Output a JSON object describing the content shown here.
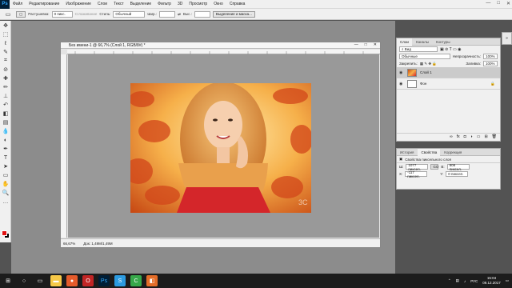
{
  "app": {
    "logo": "Ps"
  },
  "menu": [
    "Файл",
    "Редактирование",
    "Изображение",
    "Слои",
    "Текст",
    "Выделение",
    "Фильтр",
    "3D",
    "Просмотр",
    "Окно",
    "Справка"
  ],
  "window_controls": [
    "—",
    "□",
    "✕"
  ],
  "options": {
    "feather_label": "Растушевка:",
    "feather_value": "0 пикс.",
    "smoothing_label": "Сглаживание",
    "style_label": "Стиль:",
    "style_value": "Обычный",
    "width_label": "Шир.:",
    "height_label": "Выс.:",
    "select_mask_btn": "Выделение и маска..."
  },
  "document": {
    "title": "Без имени-1 @ 66,7% (Слой 1, RGB/8#) *",
    "zoom": "66,67%",
    "doc_info": "Док: 1,49M/1,49M",
    "watermark": "3C"
  },
  "layers_panel": {
    "tabs": [
      "Слои",
      "Каналы",
      "Контуры"
    ],
    "kind_label": "Вид",
    "blend_mode": "Обычные",
    "opacity_label": "Непрозрачность:",
    "opacity_value": "100%",
    "lock_label": "Закрепить:",
    "fill_label": "Заливка:",
    "fill_value": "100%",
    "layers": [
      {
        "name": "Слой 1",
        "selected": true
      },
      {
        "name": "Фон",
        "selected": false
      }
    ]
  },
  "props_panel": {
    "tabs": [
      "История",
      "Свойства",
      "Коррекция"
    ],
    "title": "Свойства пиксельного слоя",
    "w_label": "Ш:",
    "w_value": "1077 пиксел.",
    "h_label": "В:",
    "h_value": "808 пиксел.",
    "x_label": "X:",
    "x_value": "-117 пиксел.",
    "y_label": "Y:",
    "y_value": "0 пиксел.",
    "link_label": "GO"
  },
  "taskbar": {
    "lang": "РУС",
    "time": "15:04",
    "date": "09.12.2017"
  },
  "colors": {
    "foreground": "#e01010",
    "background": "#000000"
  }
}
